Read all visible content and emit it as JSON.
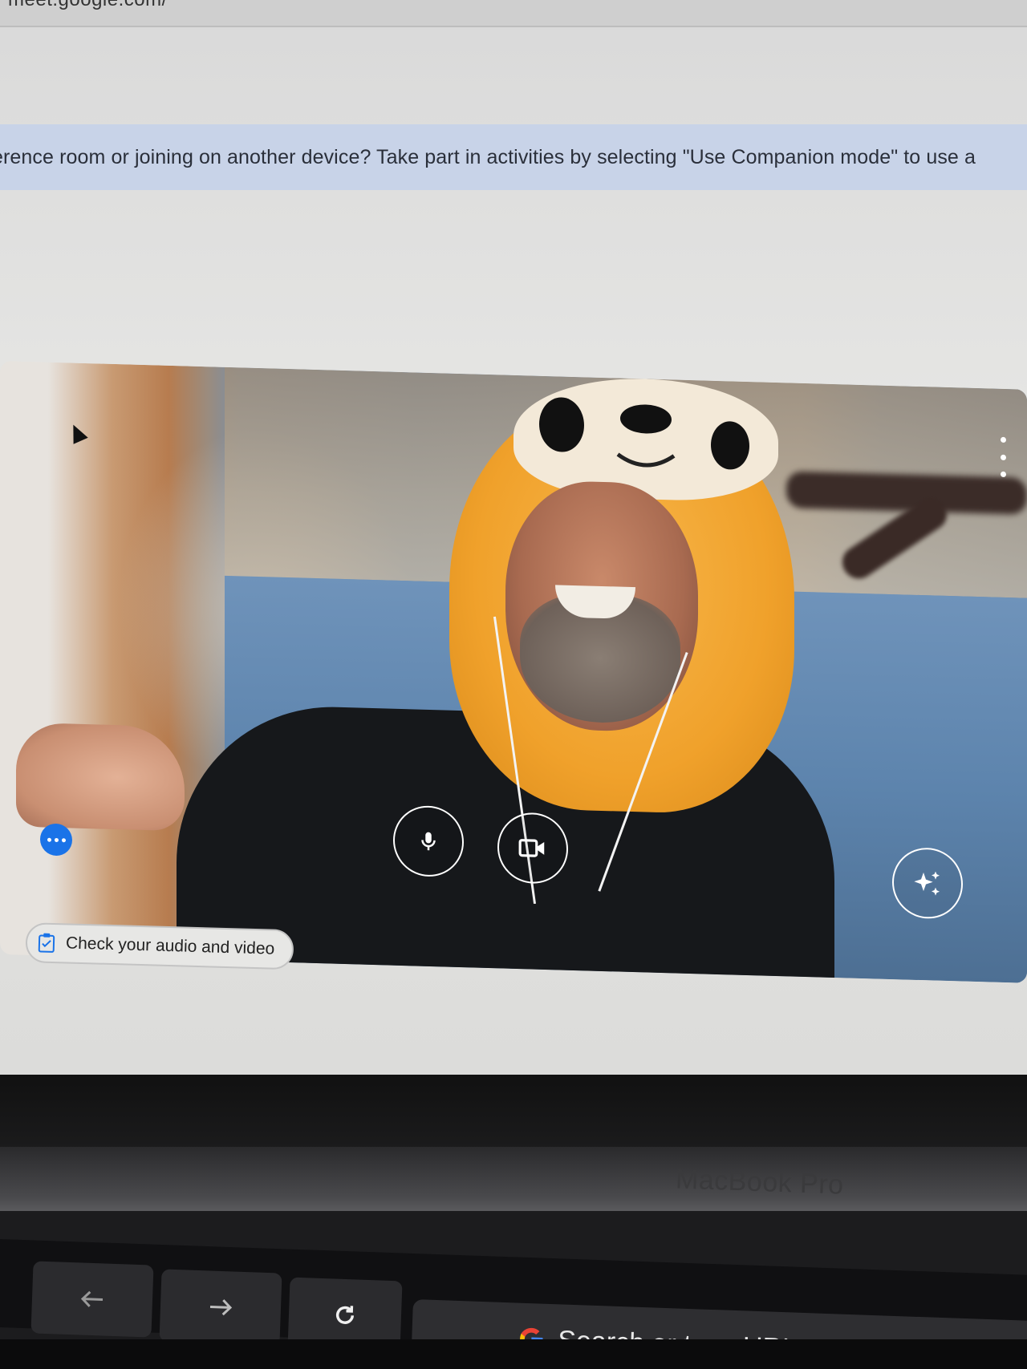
{
  "browser": {
    "url_fragment": "meet.google.com/"
  },
  "banner": {
    "text": "erence room or joining on another device? Take part in activities by selecting \"Use Companion mode\" to use a"
  },
  "preview": {
    "controls": {
      "mic_icon": "microphone-icon",
      "camera_icon": "video-camera-icon",
      "effects_icon": "sparkle-effects-icon",
      "more_icon": "vertical-more-icon",
      "options_icon": "horizontal-more-icon"
    }
  },
  "check_chip": {
    "label": "Check your audio and video",
    "icon": "clipboard-check-icon"
  },
  "device": {
    "brand": "MacBook Pro"
  },
  "touchbar": {
    "back_icon": "arrow-left-icon",
    "forward_icon": "arrow-right-icon",
    "reload_icon": "reload-icon",
    "search_label": "Search or type URL",
    "search_icon": "google-g-icon"
  },
  "colors": {
    "banner_bg": "#c8d3e8",
    "accent_blue": "#1a73e8",
    "page_bg": "#e6e6e4"
  }
}
